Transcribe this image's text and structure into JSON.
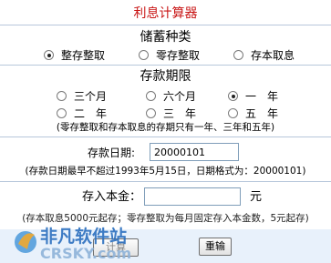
{
  "app": {
    "title": "利息计算器"
  },
  "savings_type": {
    "heading": "储蓄种类",
    "options": [
      {
        "label": "整存整取",
        "checked": true
      },
      {
        "label": "零存整取",
        "checked": false
      },
      {
        "label": "存本取息",
        "checked": false
      }
    ]
  },
  "term": {
    "heading": "存款期限",
    "options": [
      {
        "label": "三个月",
        "checked": false
      },
      {
        "label": "六个月",
        "checked": false
      },
      {
        "label": "一　年",
        "checked": true
      },
      {
        "label": "二　年",
        "checked": false
      },
      {
        "label": "三　年",
        "checked": false
      },
      {
        "label": "五　年",
        "checked": false
      }
    ],
    "note": "(零存整取和存本取息的存期只有一年、三年和五年)"
  },
  "deposit_date": {
    "label": "存款日期:",
    "value": "20000101",
    "note": "(存款日期最早不超过1993年5月15日，日期格式为：20000101)"
  },
  "principal": {
    "label": "存入本金：",
    "value": "",
    "unit": "元",
    "note": "(存本取息5000元起存；零存整取为每月固定存入本金数，5元起存)"
  },
  "buttons": {
    "calculate": "计算",
    "reset": "重输"
  },
  "watermark": {
    "cn": "非凡软件站",
    "en": "CRSKY.com"
  }
}
